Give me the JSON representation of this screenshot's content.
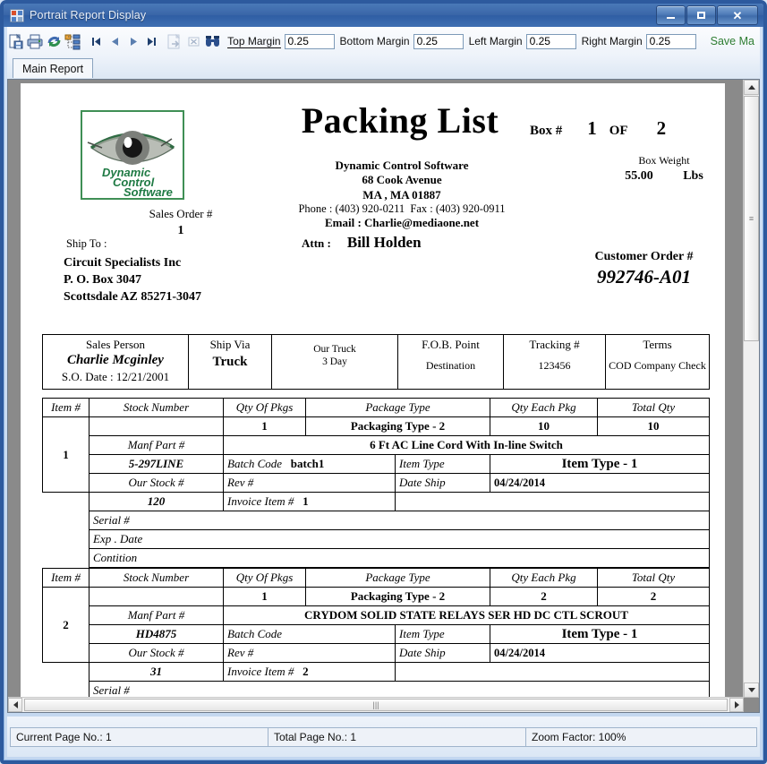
{
  "window": {
    "title": "Portrait Report Display",
    "icon": "app-icon",
    "minimize": "–",
    "maximize": "□",
    "close": "✕"
  },
  "toolbar": {
    "icons": [
      {
        "name": "export-report-icon",
        "glyph": "export"
      },
      {
        "name": "print-report-icon",
        "glyph": "print"
      },
      {
        "name": "refresh-icon",
        "glyph": "refresh"
      },
      {
        "name": "toggle-group-tree-icon",
        "glyph": "tree"
      },
      {
        "name": "go-to-first-page-icon",
        "glyph": "first"
      },
      {
        "name": "go-to-previous-page-icon",
        "glyph": "prev"
      },
      {
        "name": "go-to-next-page-icon",
        "glyph": "next"
      },
      {
        "name": "go-to-last-page-icon",
        "glyph": "last"
      },
      {
        "name": "drill-down-icon",
        "glyph": "drill"
      },
      {
        "name": "close-current-view-icon",
        "glyph": "closeview"
      },
      {
        "name": "search-icon",
        "glyph": "binoculars"
      }
    ],
    "top_margin_label": "Top Margin",
    "top_margin_value": "0.25",
    "bottom_margin_label": "Bottom Margin",
    "bottom_margin_value": "0.25",
    "left_margin_label": "Left Margin",
    "left_margin_value": "0.25",
    "right_margin_label": "Right Margin",
    "right_margin_value": "0.25",
    "save_label": "Save Ma",
    "save_color": "#2e7d32"
  },
  "tabs": [
    {
      "label": "Main Report",
      "active": true
    }
  ],
  "report": {
    "title": "Packing List",
    "logo": {
      "line1": "Dynamic",
      "line2": "Control",
      "line3": "Software",
      "color": "#1f7a44",
      "border_color": "#3f8f55"
    },
    "company": {
      "name": "Dynamic Control Software",
      "street": "68 Cook Avenue",
      "citystate": "MA , MA 01887",
      "phone_label": "Phone :",
      "phone": "(403) 920-0211",
      "fax_label": "Fax :",
      "fax": "(403) 920-0911",
      "email_label": "Email :",
      "email": "Charlie@mediaone.net"
    },
    "box": {
      "label": "Box #",
      "number": "1",
      "of": "OF",
      "total": "2",
      "weight_label": "Box Weight",
      "weight": "55.00",
      "weight_unit": "Lbs"
    },
    "sales_order": {
      "label": "Sales Order #",
      "value": "1"
    },
    "ship_to": {
      "label": "Ship To :",
      "line1": "Circuit Specialists Inc",
      "line2": "P. O. Box 3047",
      "line3": "Scottsdale AZ 85271-3047"
    },
    "attn": {
      "label": "Attn :",
      "value": "Bill Holden"
    },
    "customer_order": {
      "label": "Customer Order #",
      "value": "992746-A01"
    },
    "info_row": {
      "sales_person_label": "Sales Person",
      "sales_person": "Charlie Mcginley",
      "so_date": "S.O. Date :  12/21/2001",
      "ship_via_label": "Ship Via",
      "ship_via": "Truck",
      "carrier": "Our Truck",
      "service": "3 Day",
      "fob_label": "F.O.B. Point",
      "fob": "Destination",
      "tracking_label": "Tracking #",
      "tracking": "123456",
      "terms_label": "Terms",
      "terms": "COD Company Check"
    },
    "item_headers": {
      "item_no": "Item #",
      "stock_number": "Stock Number",
      "qty_of_pkgs": "Qty Of Pkgs",
      "package_type": "Package Type",
      "qty_each_pkg": "Qty Each Pkg",
      "total_qty": "Total Qty"
    },
    "sub_labels": {
      "manf_part": "Manf Part #",
      "our_stock": "Our Stock #",
      "batch_code": "Batch Code",
      "rev": "Rev #",
      "invoice_item": "Invoice Item #",
      "item_type": "Item Type",
      "date_ship": "Date Ship",
      "serial": "Serial  #",
      "exp_date": "Exp . Date",
      "contition": "Contition"
    },
    "items": [
      {
        "item_no": "1",
        "qty_of_pkgs": "1",
        "package_type": "Packaging Type - 2",
        "qty_each_pkg": "10",
        "total_qty": "10",
        "description": "6 Ft AC Line Cord With In-line Switch",
        "manf_part": "5-297LINE",
        "our_stock": "120",
        "batch_code": "batch1",
        "rev": "",
        "invoice_item": "1",
        "item_type": "Item Type - 1",
        "date_ship": "04/24/2014",
        "serial": "",
        "exp_date": "",
        "contition": ""
      },
      {
        "item_no": "2",
        "qty_of_pkgs": "1",
        "package_type": "Packaging Type - 2",
        "qty_each_pkg": "2",
        "total_qty": "2",
        "description": "CRYDOM SOLID STATE RELAYS SER HD DC CTL SCROUT",
        "manf_part": "HD4875",
        "our_stock": "31",
        "batch_code": "",
        "rev": "",
        "invoice_item": "2",
        "item_type": "Item Type - 1",
        "date_ship": "04/24/2014",
        "serial": "",
        "exp_date": "",
        "contition": ""
      }
    ]
  },
  "statusbar": {
    "current_page": "Current Page No.: 1",
    "total_page": "Total Page No.: 1",
    "zoom_factor": "Zoom Factor: 100%"
  }
}
